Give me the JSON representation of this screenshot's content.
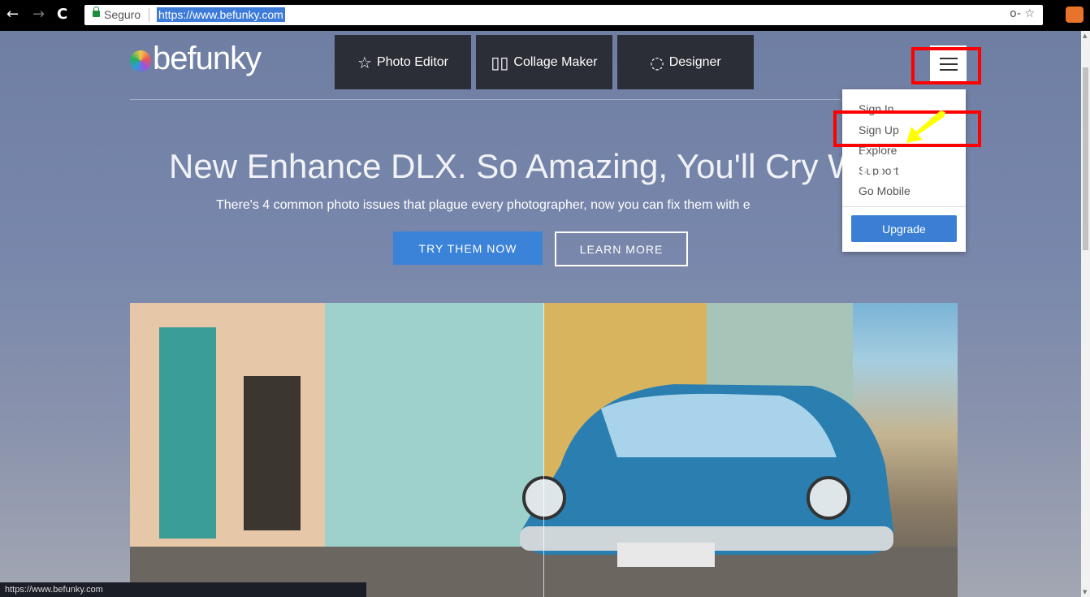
{
  "browser": {
    "back_icon": "←",
    "forward_icon": "→",
    "reload_icon": "C",
    "secure_label": "Seguro",
    "url": "https://www.befunky.com",
    "key_icon": "o-",
    "star_icon": "☆"
  },
  "site": {
    "logo": "befunky",
    "nav": [
      {
        "label": "Photo Editor",
        "icon": "☆"
      },
      {
        "label": "Collage Maker",
        "icon": "▯▯"
      },
      {
        "label": "Designer",
        "icon": "◌"
      }
    ],
    "menu": {
      "items": [
        "Sign In",
        "Sign Up",
        "Explore",
        "Support",
        "Go Mobile"
      ],
      "upgrade": "Upgrade"
    },
    "hero": {
      "headline": "New Enhance DLX. So Amazing, You'll Cry With",
      "subheadline": "There's 4 common photo issues that plague every photographer, now you can fix them with e",
      "try_button": "TRY THEM NOW",
      "learn_button": "LEARN MORE"
    }
  },
  "status_bar": {
    "url": "https://www.befunky.com"
  },
  "colors": {
    "annotation": "#ff0000",
    "arrow": "#ffff00",
    "primary": "#3b82d9"
  }
}
